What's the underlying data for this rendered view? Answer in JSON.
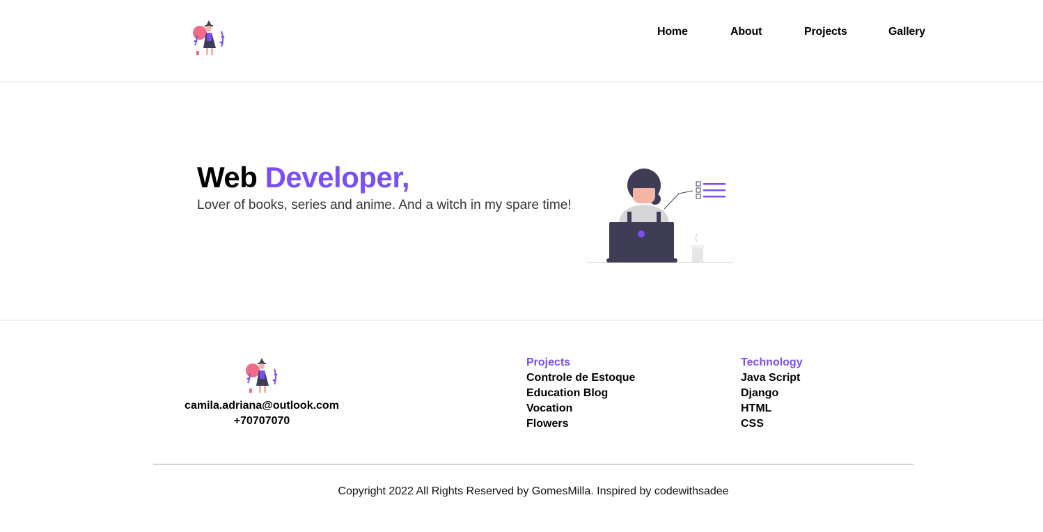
{
  "nav": {
    "items": [
      {
        "label": "Home"
      },
      {
        "label": "About"
      },
      {
        "label": "Projects"
      },
      {
        "label": "Gallery"
      }
    ]
  },
  "hero": {
    "title_plain": "Web ",
    "title_accent": "Developer,",
    "subtitle": "Lover of books, series and anime. And a witch in my spare time!"
  },
  "footer": {
    "email": "camila.adriana@outlook.com",
    "phone": "+70707070",
    "projects": {
      "heading": "Projects",
      "items": [
        "Controle de Estoque",
        "Education Blog",
        "Vocation",
        "Flowers"
      ]
    },
    "technology": {
      "heading": "Technology",
      "items": [
        "Java Script",
        "Django",
        "HTML",
        "CSS"
      ]
    },
    "copyright": "Copyright 2022 All Rights Reserved by GomesMilla. Inspired by codewithsadee"
  },
  "colors": {
    "accent": "#7b4ff5",
    "dark": "#3f3d56",
    "pink": "#f06a8a"
  },
  "icons": {
    "logo": "witch-illustration-logo",
    "hero": "woman-at-laptop-illustration"
  }
}
